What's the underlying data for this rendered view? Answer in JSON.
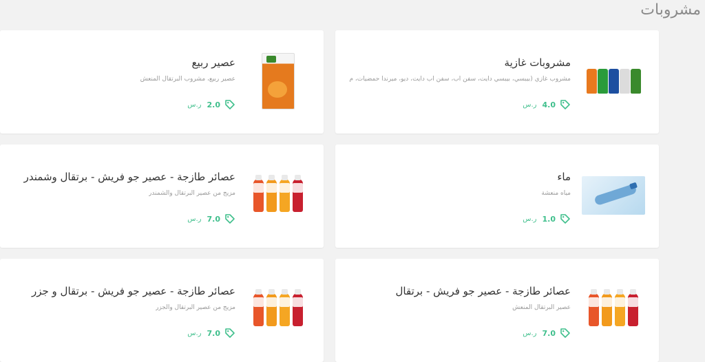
{
  "section": {
    "title": "مشروبات"
  },
  "products": [
    {
      "name": "مشروبات غازية",
      "desc": "مشروب غازي (بيبسي، بيبسي دايت، سفن اب، سفن اب دايت، ديو، ميرندا حمضيات، م",
      "price": "4.0",
      "currency": "ر.س",
      "image": "soda-cans-image"
    },
    {
      "name": "عصير ربيع",
      "desc": "عصير ربيع، مشروب البرتقال المنعش",
      "price": "2.0",
      "currency": "ر.س",
      "image": "juice-box-image"
    },
    {
      "name": "ماء",
      "desc": "مياه منعشة",
      "price": "1.0",
      "currency": "ر.س",
      "image": "water-bottle-image"
    },
    {
      "name": "عصائر طازجة - عصير جو فريش - برتقال وشمندر",
      "desc": "مزيج من عصير البرتقال والشمندر",
      "price": "7.0",
      "currency": "ر.س",
      "image": "juice-bottles-image"
    },
    {
      "name": "عصائر طازجة - عصير جو فريش - برتقال",
      "desc": "عصير البرتقال المنعش",
      "price": "7.0",
      "currency": "ر.س",
      "image": "juice-bottles-image"
    },
    {
      "name": "عصائر طازجة - عصير جو فريش - برتقال و جزر",
      "desc": "مزيج من عصير البرتقال والجزر",
      "price": "7.0",
      "currency": "ر.س",
      "image": "juice-bottles-image"
    }
  ],
  "colors": {
    "accent": "#3fbf8c",
    "card_bg": "#ffffff",
    "page_bg": "#f2f2f2"
  }
}
